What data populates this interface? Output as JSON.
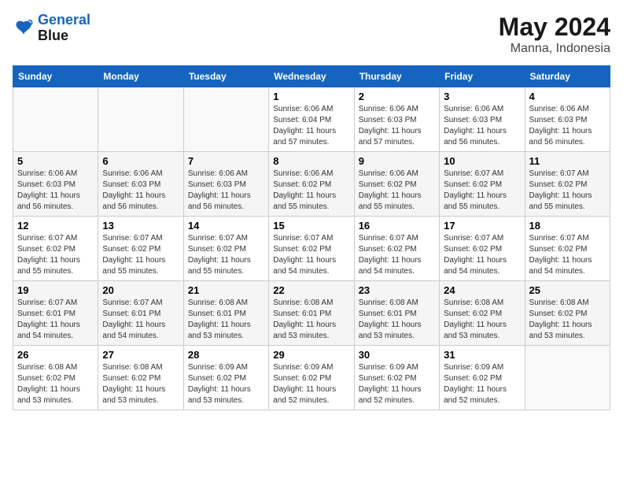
{
  "logo": {
    "line1": "General",
    "line2": "Blue"
  },
  "title": "May 2024",
  "subtitle": "Manna, Indonesia",
  "days_of_week": [
    "Sunday",
    "Monday",
    "Tuesday",
    "Wednesday",
    "Thursday",
    "Friday",
    "Saturday"
  ],
  "weeks": [
    [
      {
        "day": "",
        "info": ""
      },
      {
        "day": "",
        "info": ""
      },
      {
        "day": "",
        "info": ""
      },
      {
        "day": "1",
        "sunrise": "6:06 AM",
        "sunset": "6:04 PM",
        "daylight": "11 hours and 57 minutes."
      },
      {
        "day": "2",
        "sunrise": "6:06 AM",
        "sunset": "6:03 PM",
        "daylight": "11 hours and 57 minutes."
      },
      {
        "day": "3",
        "sunrise": "6:06 AM",
        "sunset": "6:03 PM",
        "daylight": "11 hours and 56 minutes."
      },
      {
        "day": "4",
        "sunrise": "6:06 AM",
        "sunset": "6:03 PM",
        "daylight": "11 hours and 56 minutes."
      }
    ],
    [
      {
        "day": "5",
        "sunrise": "6:06 AM",
        "sunset": "6:03 PM",
        "daylight": "11 hours and 56 minutes."
      },
      {
        "day": "6",
        "sunrise": "6:06 AM",
        "sunset": "6:03 PM",
        "daylight": "11 hours and 56 minutes."
      },
      {
        "day": "7",
        "sunrise": "6:06 AM",
        "sunset": "6:03 PM",
        "daylight": "11 hours and 56 minutes."
      },
      {
        "day": "8",
        "sunrise": "6:06 AM",
        "sunset": "6:02 PM",
        "daylight": "11 hours and 55 minutes."
      },
      {
        "day": "9",
        "sunrise": "6:06 AM",
        "sunset": "6:02 PM",
        "daylight": "11 hours and 55 minutes."
      },
      {
        "day": "10",
        "sunrise": "6:07 AM",
        "sunset": "6:02 PM",
        "daylight": "11 hours and 55 minutes."
      },
      {
        "day": "11",
        "sunrise": "6:07 AM",
        "sunset": "6:02 PM",
        "daylight": "11 hours and 55 minutes."
      }
    ],
    [
      {
        "day": "12",
        "sunrise": "6:07 AM",
        "sunset": "6:02 PM",
        "daylight": "11 hours and 55 minutes."
      },
      {
        "day": "13",
        "sunrise": "6:07 AM",
        "sunset": "6:02 PM",
        "daylight": "11 hours and 55 minutes."
      },
      {
        "day": "14",
        "sunrise": "6:07 AM",
        "sunset": "6:02 PM",
        "daylight": "11 hours and 55 minutes."
      },
      {
        "day": "15",
        "sunrise": "6:07 AM",
        "sunset": "6:02 PM",
        "daylight": "11 hours and 54 minutes."
      },
      {
        "day": "16",
        "sunrise": "6:07 AM",
        "sunset": "6:02 PM",
        "daylight": "11 hours and 54 minutes."
      },
      {
        "day": "17",
        "sunrise": "6:07 AM",
        "sunset": "6:02 PM",
        "daylight": "11 hours and 54 minutes."
      },
      {
        "day": "18",
        "sunrise": "6:07 AM",
        "sunset": "6:02 PM",
        "daylight": "11 hours and 54 minutes."
      }
    ],
    [
      {
        "day": "19",
        "sunrise": "6:07 AM",
        "sunset": "6:01 PM",
        "daylight": "11 hours and 54 minutes."
      },
      {
        "day": "20",
        "sunrise": "6:07 AM",
        "sunset": "6:01 PM",
        "daylight": "11 hours and 54 minutes."
      },
      {
        "day": "21",
        "sunrise": "6:08 AM",
        "sunset": "6:01 PM",
        "daylight": "11 hours and 53 minutes."
      },
      {
        "day": "22",
        "sunrise": "6:08 AM",
        "sunset": "6:01 PM",
        "daylight": "11 hours and 53 minutes."
      },
      {
        "day": "23",
        "sunrise": "6:08 AM",
        "sunset": "6:01 PM",
        "daylight": "11 hours and 53 minutes."
      },
      {
        "day": "24",
        "sunrise": "6:08 AM",
        "sunset": "6:02 PM",
        "daylight": "11 hours and 53 minutes."
      },
      {
        "day": "25",
        "sunrise": "6:08 AM",
        "sunset": "6:02 PM",
        "daylight": "11 hours and 53 minutes."
      }
    ],
    [
      {
        "day": "26",
        "sunrise": "6:08 AM",
        "sunset": "6:02 PM",
        "daylight": "11 hours and 53 minutes."
      },
      {
        "day": "27",
        "sunrise": "6:08 AM",
        "sunset": "6:02 PM",
        "daylight": "11 hours and 53 minutes."
      },
      {
        "day": "28",
        "sunrise": "6:09 AM",
        "sunset": "6:02 PM",
        "daylight": "11 hours and 53 minutes."
      },
      {
        "day": "29",
        "sunrise": "6:09 AM",
        "sunset": "6:02 PM",
        "daylight": "11 hours and 52 minutes."
      },
      {
        "day": "30",
        "sunrise": "6:09 AM",
        "sunset": "6:02 PM",
        "daylight": "11 hours and 52 minutes."
      },
      {
        "day": "31",
        "sunrise": "6:09 AM",
        "sunset": "6:02 PM",
        "daylight": "11 hours and 52 minutes."
      },
      {
        "day": "",
        "info": ""
      }
    ]
  ]
}
